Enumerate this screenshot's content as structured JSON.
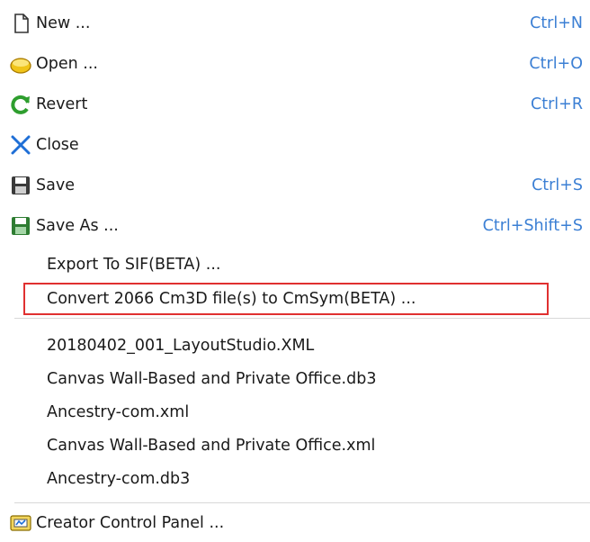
{
  "menu": {
    "items": [
      {
        "label": "New ...",
        "shortcut": "Ctrl+N",
        "icon": "new-file-icon"
      },
      {
        "label": "Open ...",
        "shortcut": "Ctrl+O",
        "icon": "open-folder-icon"
      },
      {
        "label": "Revert",
        "shortcut": "Ctrl+R",
        "icon": "revert-icon"
      },
      {
        "label": "Close",
        "shortcut": "",
        "icon": "close-icon"
      },
      {
        "label": "Save",
        "shortcut": "Ctrl+S",
        "icon": "save-icon"
      },
      {
        "label": "Save As ...",
        "shortcut": "Ctrl+Shift+S",
        "icon": "save-as-icon"
      },
      {
        "label": "Export To SIF(BETA) ..."
      },
      {
        "label": "Convert 2066 Cm3D file(s) to CmSym(BETA) ..."
      }
    ],
    "recent_files": [
      {
        "label": "20180402_001_LayoutStudio.XML"
      },
      {
        "label": "Canvas Wall-Based and Private Office.db3"
      },
      {
        "label": "Ancestry-com.xml"
      },
      {
        "label": "Canvas Wall-Based and Private Office.xml"
      },
      {
        "label": "Ancestry-com.db3"
      }
    ],
    "footer": {
      "label": "Creator Control Panel ...",
      "icon": "control-panel-icon"
    }
  },
  "colors": {
    "shortcut": "#3b7fd4",
    "highlight_border": "#e03030",
    "separator": "#d8d8d8"
  }
}
